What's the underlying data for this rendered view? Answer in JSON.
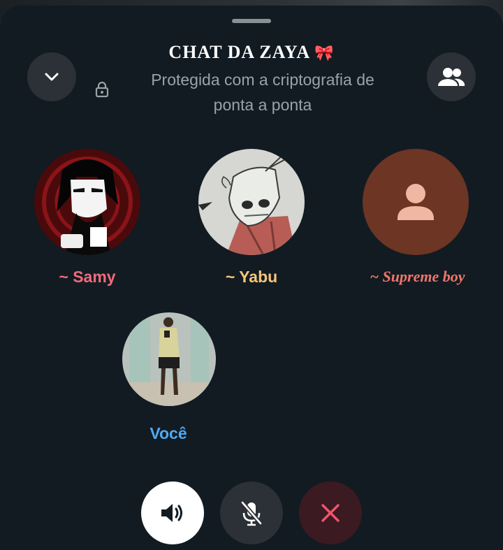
{
  "call": {
    "title": "CHAT DA ZAYA",
    "title_emoji": "🎀",
    "subtitle": "Protegida com a criptografia de ponta a ponta"
  },
  "header": {
    "collapse_icon": "chevron-down-icon",
    "lock_icon": "lock-icon",
    "participants_icon": "group-icon"
  },
  "participants": [
    {
      "name": "~ Samy",
      "color": "#f06b7a",
      "avatar": "dark-anime-girl-photo"
    },
    {
      "name": "~ Yabu",
      "color": "#f7c57a",
      "avatar": "masked-character-photo"
    },
    {
      "name": "~ Supreme boy",
      "color": "#f0766b",
      "avatar": "default-person-placeholder"
    },
    {
      "name": "Você",
      "color": "#52a8f2",
      "avatar": "mirror-selfie-photo"
    }
  ],
  "controls": {
    "speaker_icon": "speaker-icon",
    "mute_icon": "mic-off-icon",
    "end_call_icon": "close-icon",
    "end_call_color": "#f0556a"
  }
}
